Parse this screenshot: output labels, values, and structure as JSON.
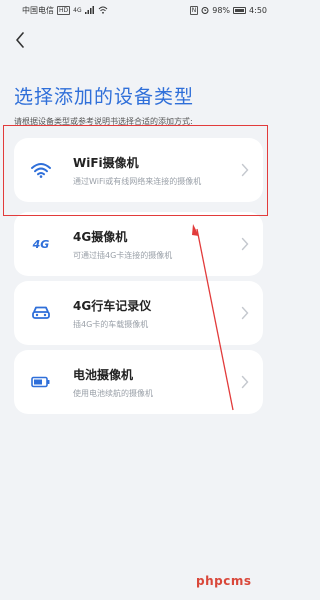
{
  "status_bar": {
    "carrier": "中国电信",
    "hd_tag": "HD",
    "network": "4G",
    "battery": "98%",
    "time": "4:50"
  },
  "header": {
    "back_icon": "chevron-left-icon",
    "title": "选择添加的设备类型",
    "subtitle": "请根据设备类型或参考说明书选择合适的添加方式:"
  },
  "devices": [
    {
      "name": "WiFi摄像机",
      "desc": "通过WiFi或有线网络来连接的摄像机",
      "icon": "wifi-icon"
    },
    {
      "name": "4G摄像机",
      "desc": "可通过插4G卡连接的摄像机",
      "icon": "4g-icon"
    },
    {
      "name": "4G行车记录仪",
      "desc": "插4G卡的车载摄像机",
      "icon": "car-icon"
    },
    {
      "name": "电池摄像机",
      "desc": "使用电池续航的摄像机",
      "icon": "battery-icon"
    }
  ],
  "icons": {
    "4g_label": "4G"
  },
  "watermark": "phpcms",
  "colors": {
    "accent": "#2f6fd9",
    "highlight": "#e23b3b",
    "background": "#f1f3f6"
  }
}
